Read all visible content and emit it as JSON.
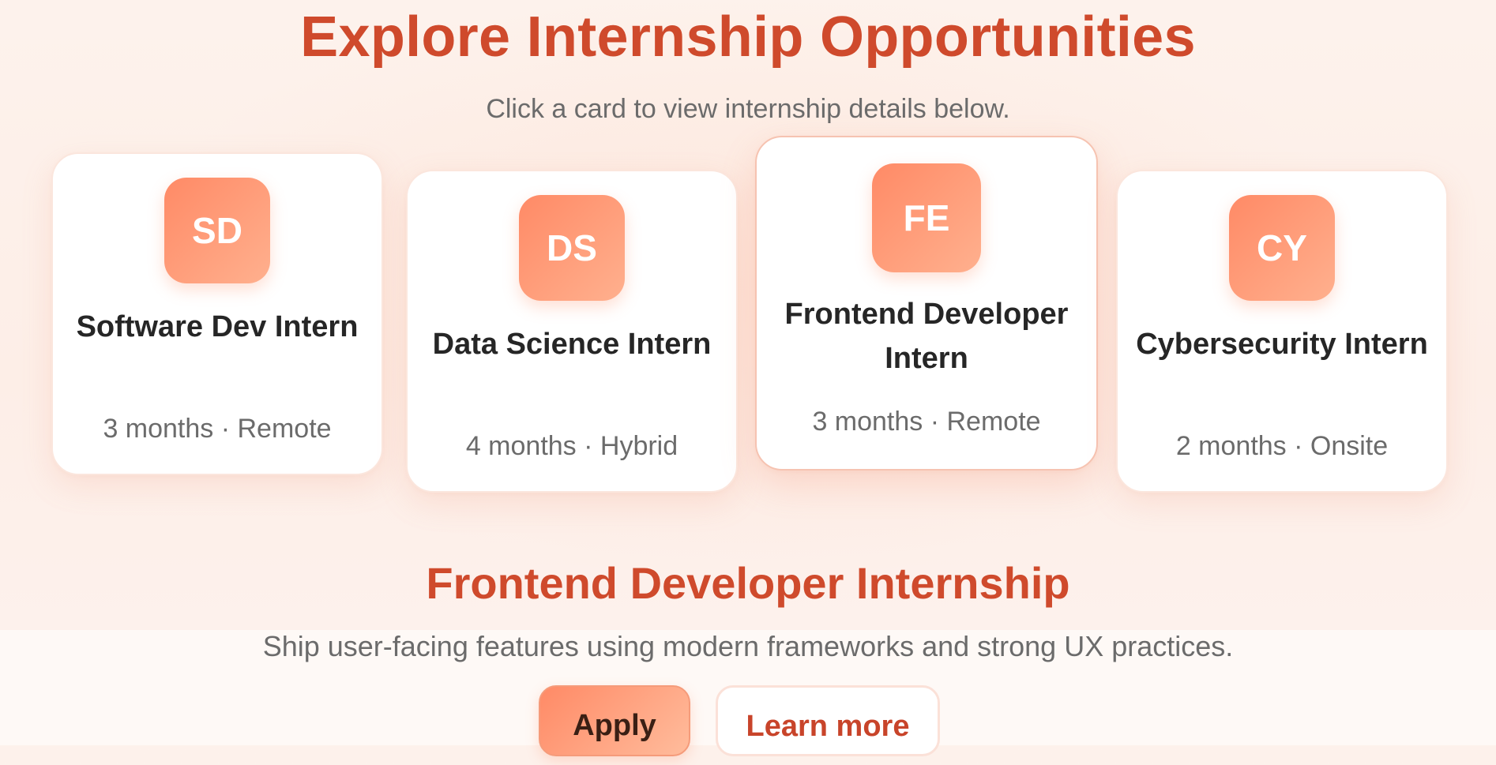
{
  "header": {
    "title": "Explore Internship Opportunities",
    "subtitle": "Click a card to view internship details below."
  },
  "cards": [
    {
      "initials": "SD",
      "title": "Software Dev Intern",
      "meta": "3 months · Remote",
      "active": false
    },
    {
      "initials": "DS",
      "title": "Data Science Intern",
      "meta": "4 months · Hybrid",
      "active": false
    },
    {
      "initials": "FE",
      "title": "Frontend Developer Intern",
      "meta": "3 months · Remote",
      "active": true
    },
    {
      "initials": "CY",
      "title": "Cybersecurity Intern",
      "meta": "2 months · Onsite",
      "active": false
    }
  ],
  "detail": {
    "title": "Frontend Developer Internship",
    "description": "Ship user-facing features using modern frameworks and strong UX practices.",
    "apply_label": "Apply",
    "learn_label": "Learn more"
  },
  "colors": {
    "accent": "#cf4a2c",
    "avatar_gradient_start": "#ff8a66",
    "avatar_gradient_end": "#ffb08e",
    "text_dark": "#262626",
    "text_muted": "#6b6b6b"
  }
}
